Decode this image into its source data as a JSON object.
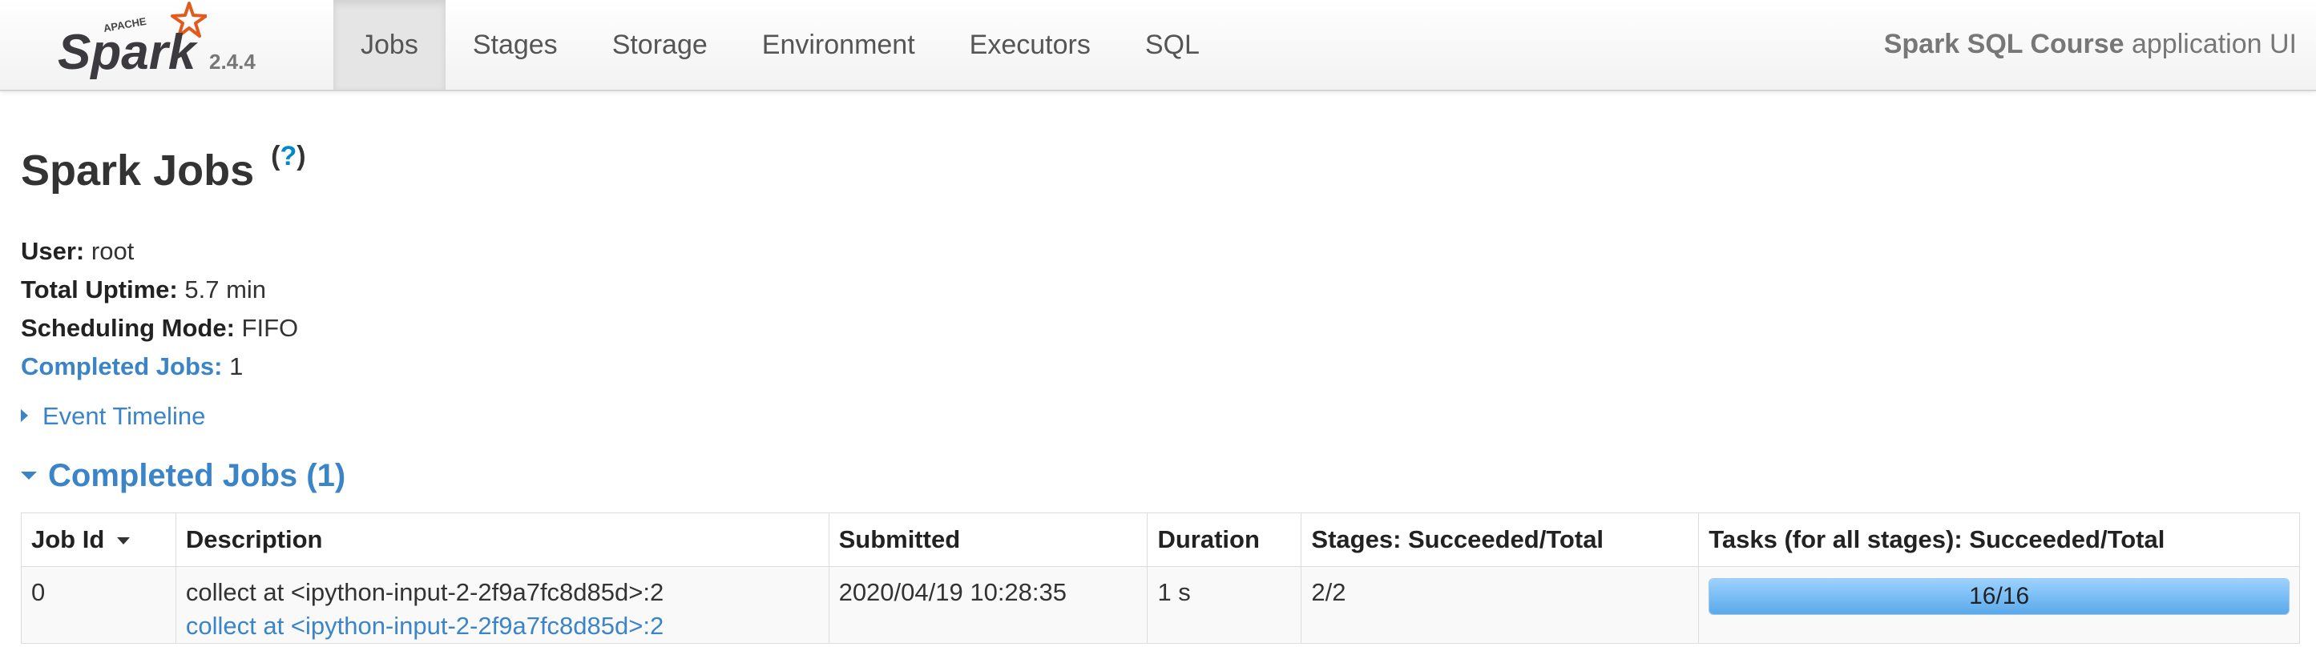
{
  "navbar": {
    "logo_text": "Spark",
    "logo_superscript": "APACHE",
    "version": "2.4.4",
    "tabs": [
      {
        "label": "Jobs",
        "active": true
      },
      {
        "label": "Stages",
        "active": false
      },
      {
        "label": "Storage",
        "active": false
      },
      {
        "label": "Environment",
        "active": false
      },
      {
        "label": "Executors",
        "active": false
      },
      {
        "label": "SQL",
        "active": false
      }
    ],
    "app_name": "Spark SQL Course",
    "app_suffix": " application UI"
  },
  "page": {
    "title": "Spark Jobs",
    "help_open": "(",
    "help_mark": "?",
    "help_close": ")"
  },
  "summary": {
    "user_label": "User:",
    "user_value": " root",
    "uptime_label": "Total Uptime:",
    "uptime_value": " 5.7 min",
    "mode_label": "Scheduling Mode:",
    "mode_value": " FIFO",
    "completed_label": "Completed Jobs:",
    "completed_value": " 1"
  },
  "event_timeline": {
    "label": "Event Timeline"
  },
  "completed_section": {
    "label": "Completed Jobs (1)"
  },
  "table": {
    "headers": {
      "job_id": "Job Id",
      "description": "Description",
      "submitted": "Submitted",
      "duration": "Duration",
      "stages": "Stages: Succeeded/Total",
      "tasks": "Tasks (for all stages): Succeeded/Total"
    },
    "rows": [
      {
        "job_id": "0",
        "description": "collect at <ipython-input-2-2f9a7fc8d85d>:2",
        "description_link": "collect at <ipython-input-2-2f9a7fc8d85d>:2",
        "submitted": "2020/04/19 10:28:35",
        "duration": "1 s",
        "stages": "2/2",
        "tasks": "16/16",
        "tasks_fraction": 1.0
      }
    ]
  },
  "colors": {
    "link": "#3b84c8",
    "progress": "#5aa9ea",
    "logo_orange": "#e25a1c"
  },
  "icons": {
    "sort": "chevron-down-icon",
    "collapsed": "triangle-right-icon",
    "expanded": "triangle-down-icon"
  }
}
